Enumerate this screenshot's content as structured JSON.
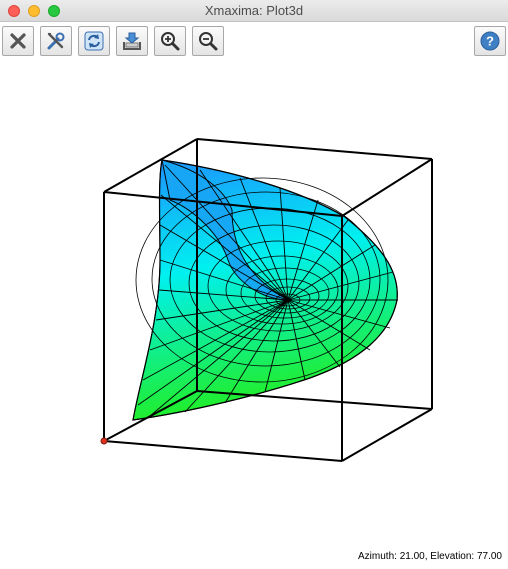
{
  "window": {
    "title": "Xmaxima: Plot3d"
  },
  "toolbar": {
    "buttons": [
      {
        "name": "close-plot-button",
        "icon": "close-x-icon"
      },
      {
        "name": "config-button",
        "icon": "tools-icon"
      },
      {
        "name": "replot-button",
        "icon": "refresh-icon"
      },
      {
        "name": "save-button",
        "icon": "save-icon"
      },
      {
        "name": "zoom-in-button",
        "icon": "zoom-in-icon"
      },
      {
        "name": "zoom-out-button",
        "icon": "zoom-out-icon"
      },
      {
        "name": "help-button",
        "icon": "help-icon"
      }
    ]
  },
  "colors": {
    "surface_top": "#1e90ff",
    "surface_mid": "#00ffff",
    "surface_bottom": "#22ee22",
    "box_edge": "#000000",
    "origin_marker": "#e03020"
  },
  "plot": {
    "type": "3d-surface",
    "view": {
      "azimuth": 21.0,
      "elevation": 77.0
    }
  },
  "status": {
    "text": "Azimuth: 21.00, Elevation: 77.00"
  }
}
